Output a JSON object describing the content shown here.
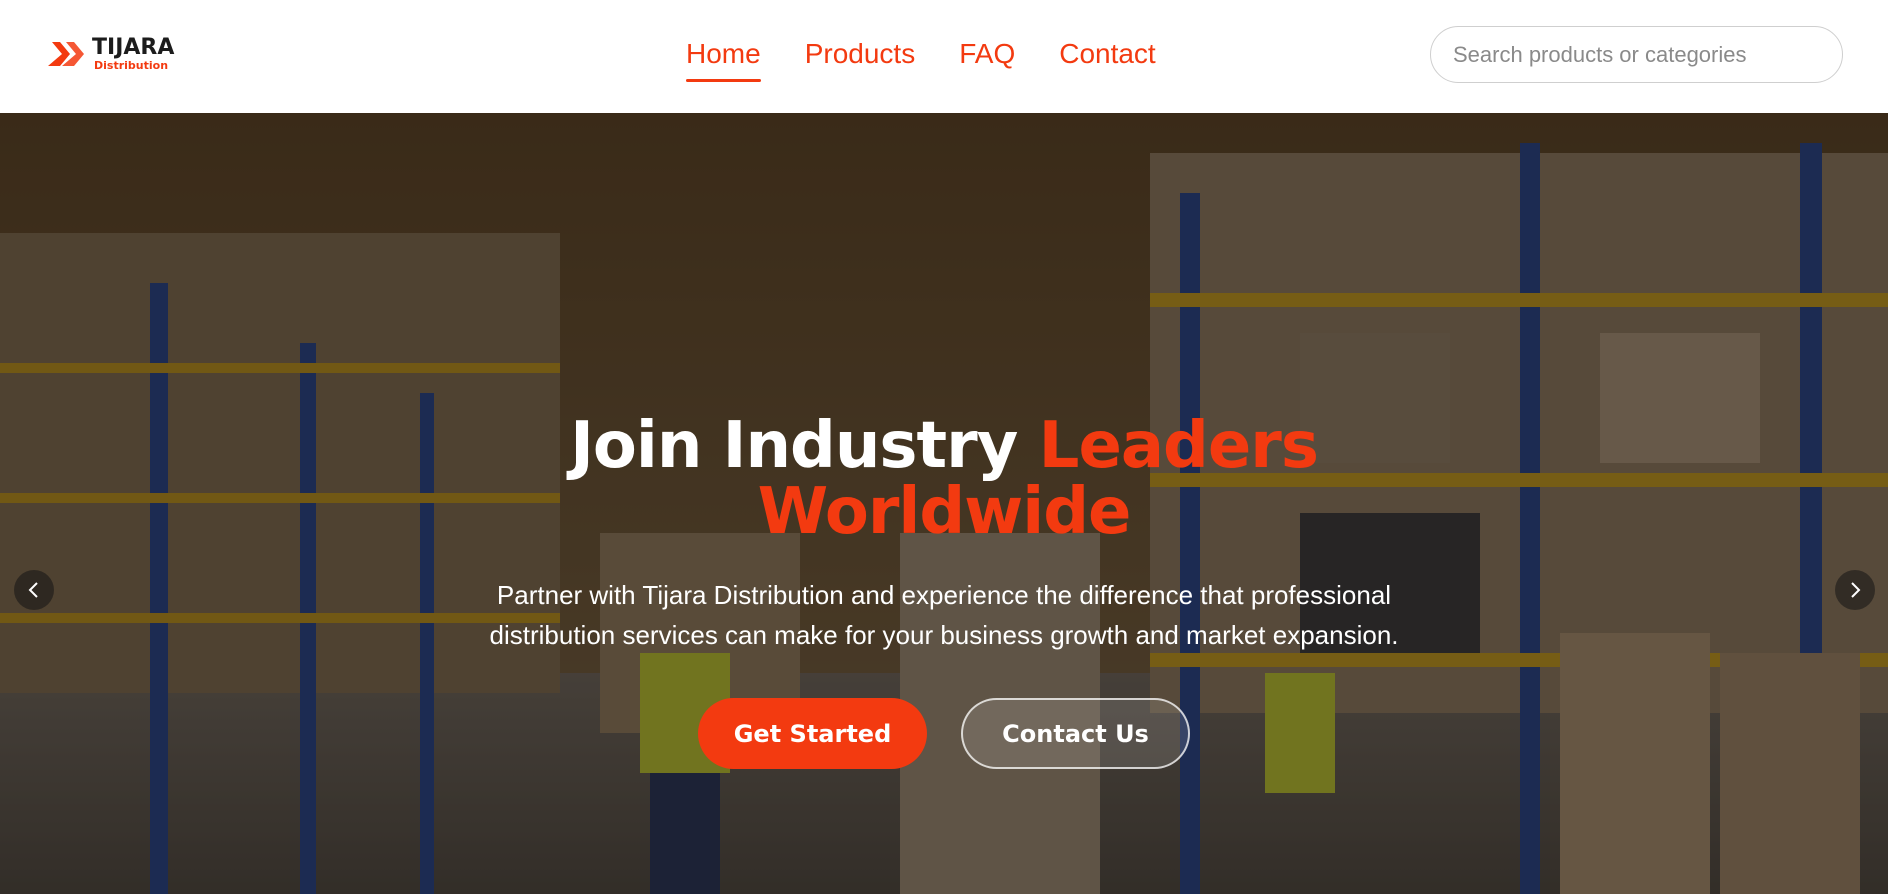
{
  "brand": {
    "name": "TIJARA",
    "tagline": "Distribution",
    "accent_color": "#f33a10"
  },
  "nav": {
    "items": [
      {
        "label": "Home",
        "active": true
      },
      {
        "label": "Products",
        "active": false
      },
      {
        "label": "FAQ",
        "active": false
      },
      {
        "label": "Contact",
        "active": false
      }
    ]
  },
  "search": {
    "placeholder": "Search products or categories",
    "value": ""
  },
  "hero": {
    "title_part1": "Join Industry ",
    "title_accent1": "Leaders",
    "title_accent2": "Worldwide",
    "subtitle": "Partner with Tijara Distribution and experience the difference that professional distribution services can make for your business growth and market expansion.",
    "primary_button": "Get Started",
    "secondary_button": "Contact Us",
    "prev_icon": "chevron-left-icon",
    "next_icon": "chevron-right-icon"
  }
}
